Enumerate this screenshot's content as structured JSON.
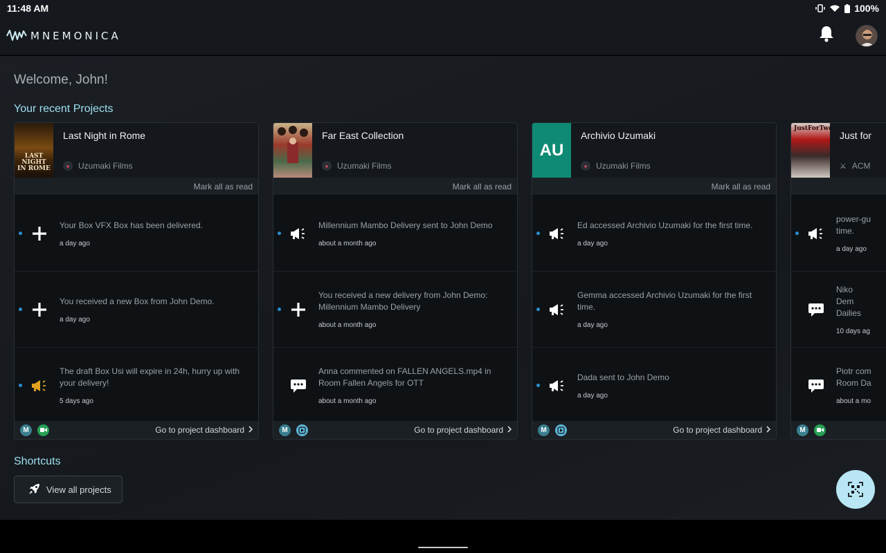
{
  "status_bar": {
    "time": "11:48 AM",
    "battery": "100%"
  },
  "app": {
    "brand": "MNEMONICA"
  },
  "welcome": "Welcome, John!",
  "recent_projects_title": "Your recent Projects",
  "shortcuts_title": "Shortcuts",
  "shortcuts": [
    {
      "label": "View all projects",
      "icon": "rocket-icon"
    }
  ],
  "projects": [
    {
      "name": "Last Night in Rome",
      "org": "Uzumaki Films",
      "thumb_text": "LAST NIGHT IN ROME",
      "mark_read": "Mark all as read",
      "dashboard_link": "Go to project dashboard",
      "notifications": [
        {
          "icon": "plus-icon",
          "text": "Your Box VFX Box has been delivered.",
          "time": "a day ago",
          "unread": true
        },
        {
          "icon": "plus-icon",
          "text": "You received a new Box from John Demo.",
          "time": "a day ago",
          "unread": true
        },
        {
          "icon": "megaphone-warning-icon",
          "text": "The draft Box Usi will expire in 24h, hurry up with your delivery!",
          "time": "5 days ago",
          "unread": true
        }
      ],
      "footer_icons": [
        "m-chip",
        "video-chip"
      ]
    },
    {
      "name": "Far East Collection",
      "org": "Uzumaki Films",
      "thumb_text": "",
      "mark_read": "Mark all as read",
      "dashboard_link": "Go to project dashboard",
      "notifications": [
        {
          "icon": "megaphone-icon",
          "text": "Millennium Mambo Delivery sent to John Demo",
          "time": "about a month ago",
          "unread": true
        },
        {
          "icon": "plus-icon",
          "text": "You received a new delivery from John Demo: Millennium Mambo Delivery",
          "time": "about a month ago",
          "unread": true
        },
        {
          "icon": "comment-icon",
          "text": "Anna commented on FALLEN ANGELS.mp4 in Room Fallen Angels for OTT",
          "time": "about a month ago",
          "unread": false
        }
      ],
      "footer_icons": [
        "m-chip",
        "play-chip"
      ]
    },
    {
      "name": "Archivio Uzumaki",
      "org": "Uzumaki Films",
      "thumb_text": "AU",
      "mark_read": "Mark all as read",
      "dashboard_link": "Go to project dashboard",
      "notifications": [
        {
          "icon": "megaphone-icon",
          "text": "Ed accessed Archivio Uzumaki for the first time.",
          "time": "a day ago",
          "unread": true
        },
        {
          "icon": "megaphone-icon",
          "text": "Gemma accessed Archivio Uzumaki for the first time.",
          "time": "a day ago",
          "unread": true
        },
        {
          "icon": "megaphone-icon",
          "text": "Dada sent to John Demo",
          "time": "a day ago",
          "unread": true
        }
      ],
      "footer_icons": [
        "m-chip",
        "play-chip"
      ]
    },
    {
      "name": "Just for",
      "org": "ACM",
      "thumb_text": "JustForTwo",
      "mark_read": "",
      "dashboard_link": "",
      "notifications": [
        {
          "icon": "megaphone-icon",
          "text": "power-gu time.",
          "time": "a day ago",
          "unread": true
        },
        {
          "icon": "comment-icon",
          "text": "Niko Dem Dailies",
          "time": "10 days ag",
          "unread": false
        },
        {
          "icon": "comment-icon",
          "text": "Piotr com Room Da",
          "time": "about a mo",
          "unread": false
        }
      ],
      "footer_icons": [
        "m-chip",
        "video-chip"
      ]
    }
  ],
  "colors": {
    "accent": "#9fdff0",
    "unread": "#2a8fd0",
    "warning": "#e0a020",
    "fab": "#b8e6f4",
    "au_tile": "#0f8a74"
  }
}
